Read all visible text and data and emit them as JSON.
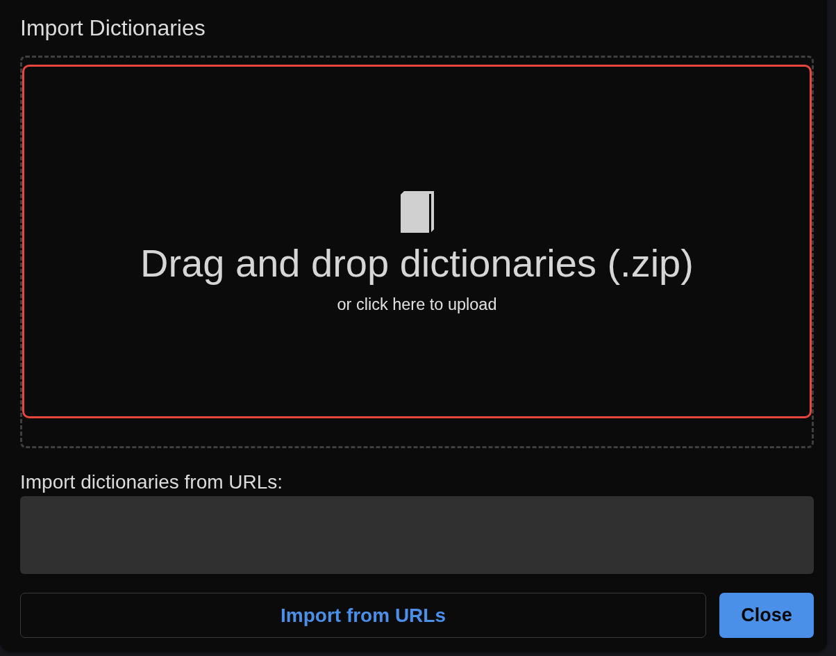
{
  "dialog": {
    "title": "Import Dictionaries"
  },
  "dropzone": {
    "highlighted": true,
    "heading": "Drag and drop dictionaries (.zip)",
    "hint": "or click here to upload"
  },
  "url_import": {
    "label": "Import dictionaries from URLs:"
  },
  "buttons": [
    {
      "label": "Import from URLs",
      "kind": "secondary"
    },
    {
      "label": "Close",
      "kind": "primary"
    }
  ]
}
